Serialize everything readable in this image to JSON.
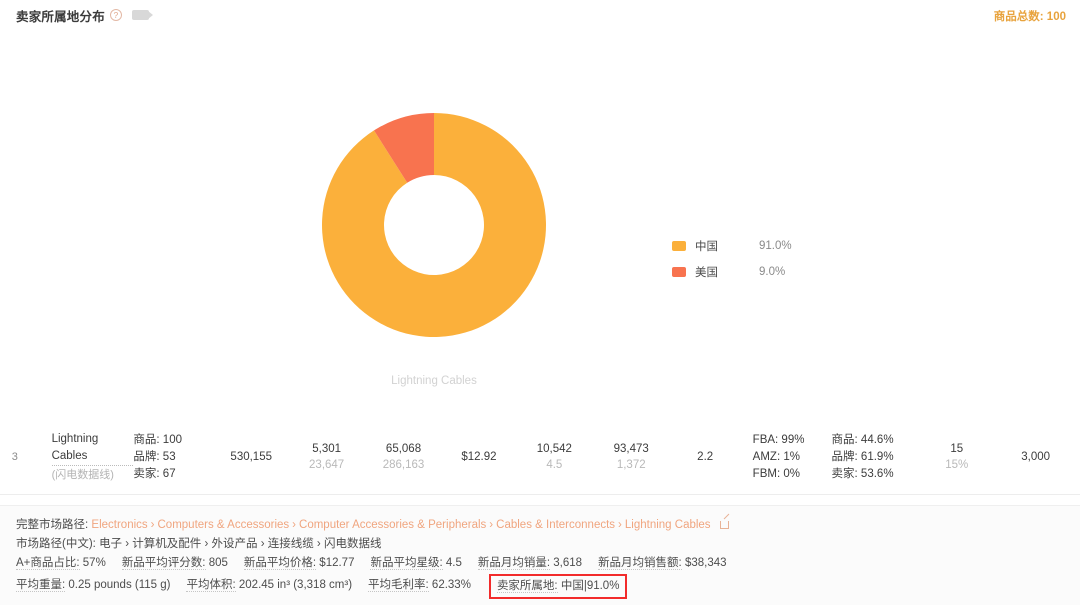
{
  "header": {
    "title": "卖家所属地分布",
    "help_icon": "question-circle-icon",
    "camera_icon": "video-icon",
    "total_label": "商品总数: 100"
  },
  "chart_data": {
    "type": "pie",
    "variant": "donut",
    "title": "卖家所属地分布",
    "caption": "Lightning Cables",
    "categories": [
      "中国",
      "美国"
    ],
    "values": [
      91.0,
      9.0
    ],
    "value_labels": [
      "91.0%",
      "9.0%"
    ],
    "colors": [
      "#FBB03B",
      "#F8734F"
    ],
    "legend_position": "right",
    "inner_radius_ratio": 0.45,
    "start_angle": 0,
    "direction": "counterclockwise"
  },
  "legend": [
    {
      "label": "中国",
      "value": "91.0%",
      "color": "#FBB03B"
    },
    {
      "label": "美国",
      "value": "9.0%",
      "color": "#F8734F"
    }
  ],
  "row": {
    "index": "3",
    "name_en": "Lightning Cables",
    "name_zh": "(闪电数据线)",
    "counts": {
      "products": "商品: 100",
      "brands": "品牌: 53",
      "sellers": "卖家: 67"
    },
    "reviews": "530,155",
    "metric_a_main": "5,301",
    "metric_a_sub": "23,647",
    "metric_b_main": "65,068",
    "metric_b_sub": "286,163",
    "price": "$12.92",
    "metric_c_main": "10,542",
    "metric_c_sub": "4.5",
    "metric_d_main": "93,473",
    "metric_d_sub": "1,372",
    "rate": "2.2",
    "fulfillment": {
      "fba": "FBA: 99%",
      "amz": "AMZ: 1%",
      "fbm": "FBM: 0%"
    },
    "percents": {
      "products": "商品: 44.6%",
      "brands": "品牌: 61.9%",
      "sellers": "卖家: 53.6%"
    },
    "rank_main": "15",
    "rank_sub": "15%",
    "last": "3,000"
  },
  "detail": {
    "full_path_label": "完整市场路径:",
    "breadcrumb": [
      "Electronics",
      "Computers & Accessories",
      "Computer Accessories & Peripherals",
      "Cables & Interconnects",
      "Lightning Cables"
    ],
    "external_icon": "external-link-icon",
    "zh_path_label": "市场路径(中文):",
    "zh_path": "电子 › 计算机及配件 › 外设产品 › 连接线缆 › 闪电数据线",
    "stats_row1": [
      {
        "key": "A+商品占比:",
        "value": "57%"
      },
      {
        "key": "新品平均评分数:",
        "value": "805"
      },
      {
        "key": "新品平均价格:",
        "value": "$12.77"
      },
      {
        "key": "新品平均星级:",
        "value": "4.5"
      },
      {
        "key": "新品月均销量:",
        "value": "3,618"
      },
      {
        "key": "新品月均销售额:",
        "value": "$38,343"
      }
    ],
    "stats_row2": [
      {
        "key": "平均重量:",
        "value": "0.25 pounds (115 g)"
      },
      {
        "key": "平均体积:",
        "value": "202.45 in³ (3,318 cm³)"
      },
      {
        "key": "平均毛利率:",
        "value": "62.33%"
      }
    ],
    "highlight": {
      "key": "卖家所属地:",
      "value": "中国|91.0%",
      "border_color": "#f22b2b"
    }
  }
}
